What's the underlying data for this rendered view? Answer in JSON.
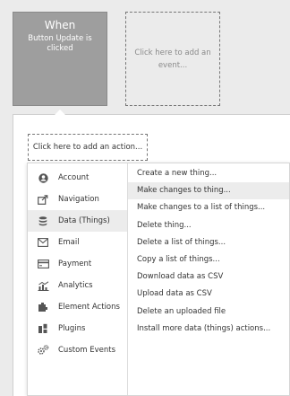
{
  "event_card": {
    "title": "When",
    "subtitle": "Button Update is clicked"
  },
  "add_event": {
    "label": "Click here to add an event..."
  },
  "add_action": {
    "label": "Click here to add an action..."
  },
  "categories": [
    {
      "label": "Account",
      "icon": "account-icon"
    },
    {
      "label": "Navigation",
      "icon": "navigation-icon"
    },
    {
      "label": "Data (Things)",
      "icon": "database-icon",
      "active": true
    },
    {
      "label": "Email",
      "icon": "email-icon"
    },
    {
      "label": "Payment",
      "icon": "payment-icon"
    },
    {
      "label": "Analytics",
      "icon": "analytics-icon"
    },
    {
      "label": "Element Actions",
      "icon": "element-actions-icon"
    },
    {
      "label": "Plugins",
      "icon": "plugins-icon"
    },
    {
      "label": "Custom Events",
      "icon": "custom-events-icon"
    }
  ],
  "actions": [
    "Create a new thing...",
    "Make changes to thing...",
    "Make changes to a list of things...",
    "Delete thing...",
    "Delete a list of things...",
    "Copy a list of things...",
    "Download data as CSV",
    "Upload data as CSV",
    "Delete an uploaded file",
    "Install more data (things) actions..."
  ],
  "colors": {
    "event_card_bg": "#9e9e9e",
    "active_row": "#ececec",
    "text": "#333333"
  }
}
